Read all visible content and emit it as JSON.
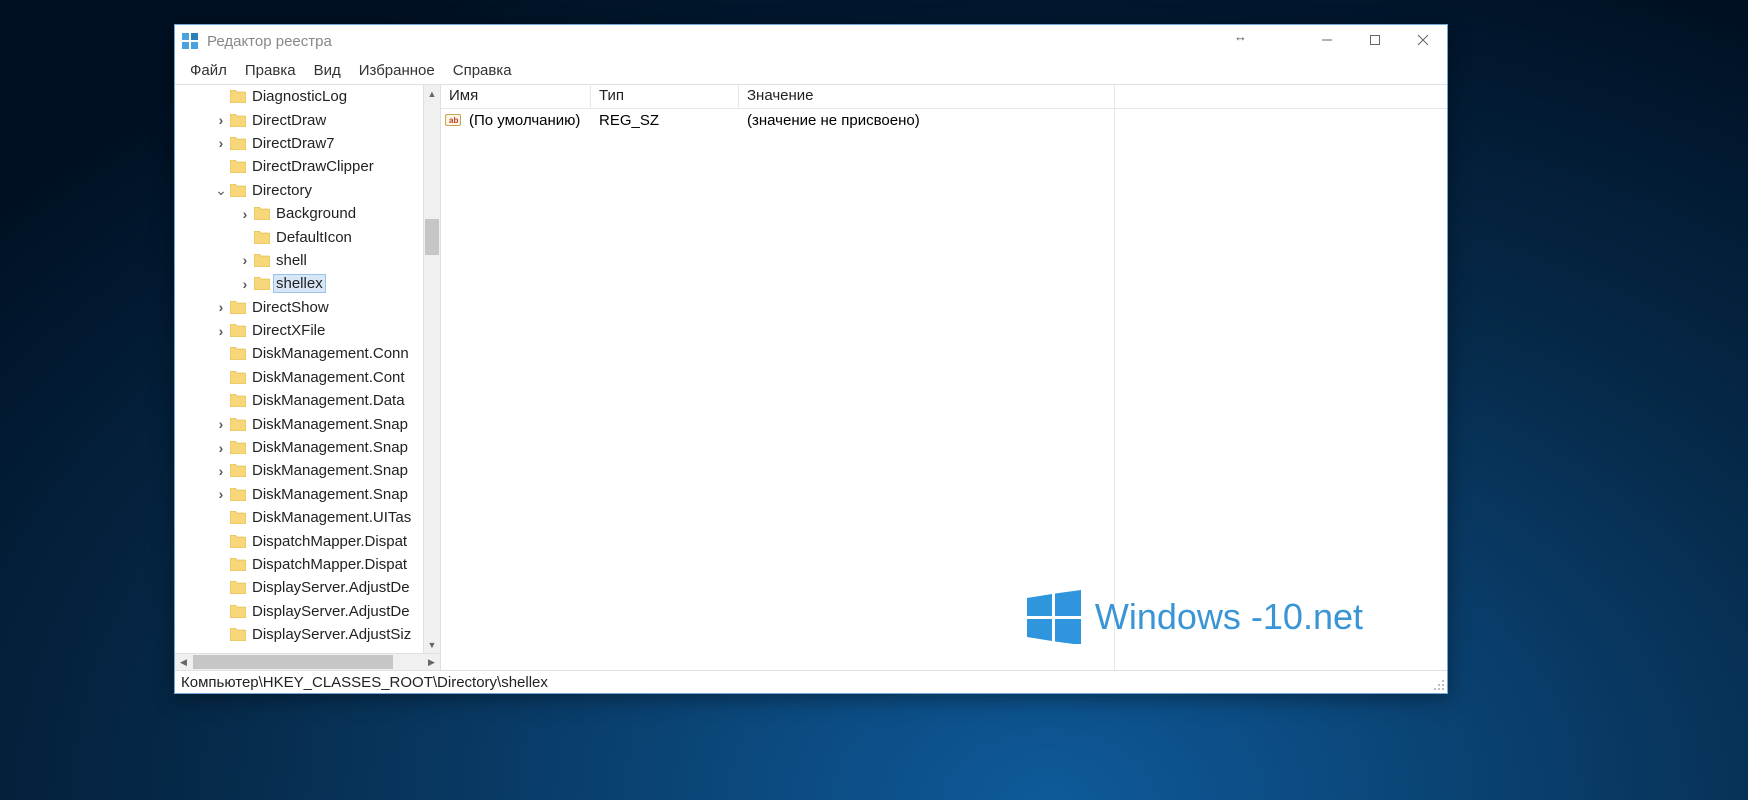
{
  "titlebar": {
    "title": "Редактор реестра"
  },
  "menu": {
    "file": "Файл",
    "edit": "Правка",
    "view": "Вид",
    "favorites": "Избранное",
    "help": "Справка"
  },
  "tree": {
    "items": [
      {
        "indent": 40,
        "twisty": "",
        "label": "DiagnosticLog"
      },
      {
        "indent": 40,
        "twisty": ">",
        "label": "DirectDraw"
      },
      {
        "indent": 40,
        "twisty": ">",
        "label": "DirectDraw7"
      },
      {
        "indent": 40,
        "twisty": "",
        "label": "DirectDrawClipper"
      },
      {
        "indent": 40,
        "twisty": "v",
        "label": "Directory"
      },
      {
        "indent": 64,
        "twisty": ">",
        "label": "Background"
      },
      {
        "indent": 64,
        "twisty": "",
        "label": "DefaultIcon"
      },
      {
        "indent": 64,
        "twisty": ">",
        "label": "shell"
      },
      {
        "indent": 64,
        "twisty": ">",
        "label": "shellex",
        "selected": true
      },
      {
        "indent": 40,
        "twisty": ">",
        "label": "DirectShow"
      },
      {
        "indent": 40,
        "twisty": ">",
        "label": "DirectXFile"
      },
      {
        "indent": 40,
        "twisty": "",
        "label": "DiskManagement.Conn"
      },
      {
        "indent": 40,
        "twisty": "",
        "label": "DiskManagement.Cont"
      },
      {
        "indent": 40,
        "twisty": "",
        "label": "DiskManagement.Data"
      },
      {
        "indent": 40,
        "twisty": ">",
        "label": "DiskManagement.Snap"
      },
      {
        "indent": 40,
        "twisty": ">",
        "label": "DiskManagement.Snap"
      },
      {
        "indent": 40,
        "twisty": ">",
        "label": "DiskManagement.Snap"
      },
      {
        "indent": 40,
        "twisty": ">",
        "label": "DiskManagement.Snap"
      },
      {
        "indent": 40,
        "twisty": "",
        "label": "DiskManagement.UITas"
      },
      {
        "indent": 40,
        "twisty": "",
        "label": "DispatchMapper.Dispat"
      },
      {
        "indent": 40,
        "twisty": "",
        "label": "DispatchMapper.Dispat"
      },
      {
        "indent": 40,
        "twisty": "",
        "label": "DisplayServer.AdjustDe"
      },
      {
        "indent": 40,
        "twisty": "",
        "label": "DisplayServer.AdjustDe"
      },
      {
        "indent": 40,
        "twisty": "",
        "label": "DisplayServer.AdjustSiz"
      }
    ]
  },
  "list": {
    "columns": {
      "name": "Имя",
      "type": "Тип",
      "value": "Значение"
    },
    "widths": {
      "name": 150,
      "type": 148,
      "value": 360
    },
    "rows": [
      {
        "name": "(По умолчанию)",
        "type": "REG_SZ",
        "value": "(значение не присвоено)"
      }
    ]
  },
  "statusbar": {
    "path": "Компьютер\\HKEY_CLASSES_ROOT\\Directory\\shellex"
  },
  "watermark": {
    "text": "Windows -10.net"
  }
}
